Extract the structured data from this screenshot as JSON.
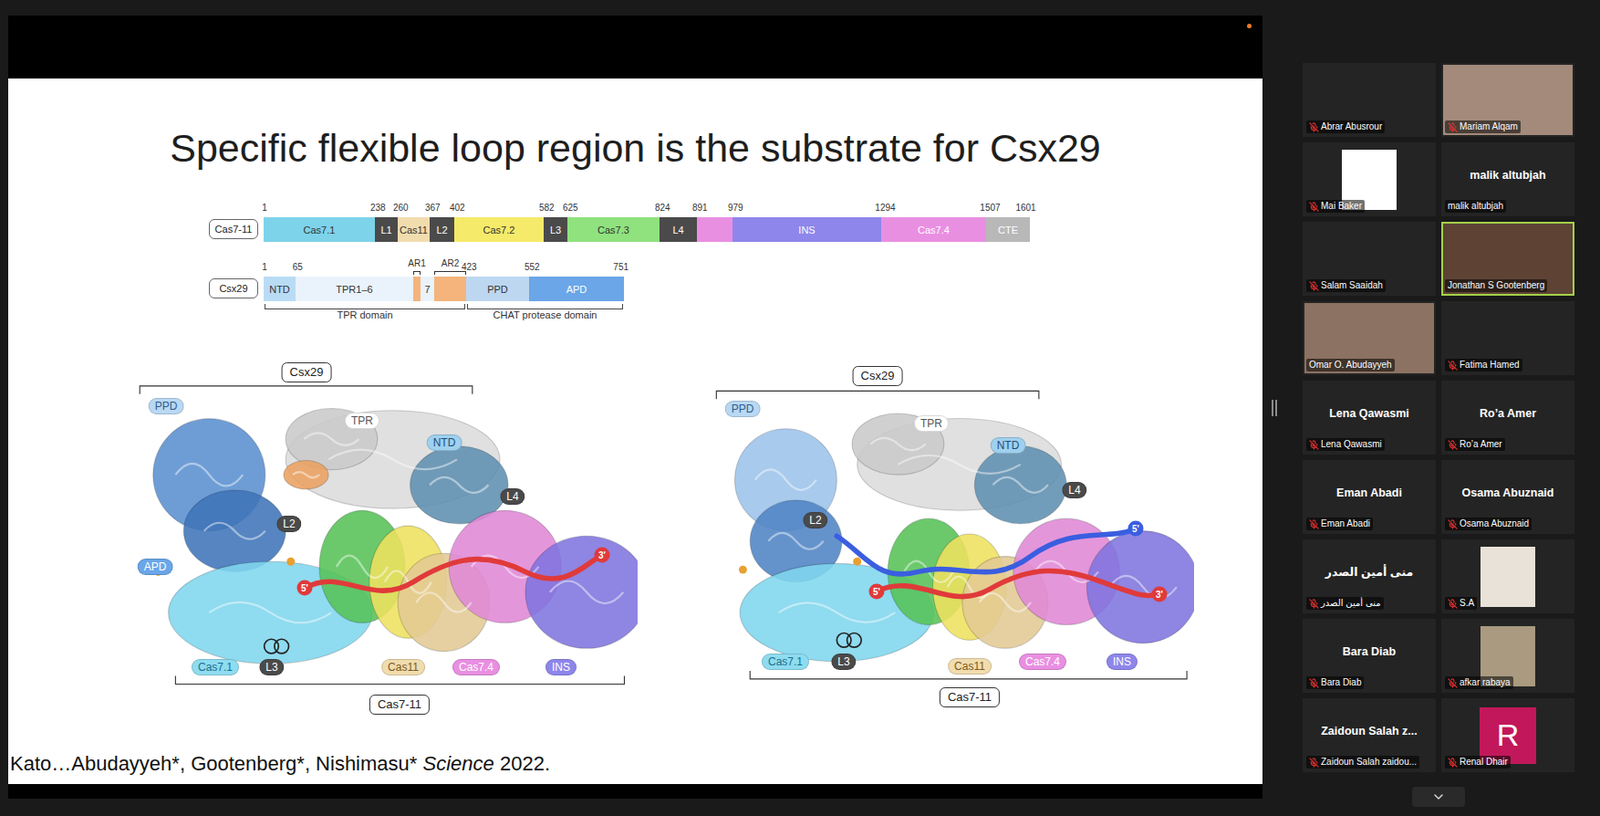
{
  "window": {
    "kind": "video-meeting"
  },
  "screen_share": {
    "slide": {
      "title": "Specific flexible loop region is the substrate for Csx29",
      "domain_maps": [
        {
          "name": "Cas7-11",
          "end": "1601",
          "segments": [
            {
              "label": "Cas7.1",
              "start": "1",
              "color": "#7dd3ea",
              "ink": "#333333"
            },
            {
              "label": "L1",
              "start": "238",
              "color": "#4a4a4a",
              "ink": "#ffffff"
            },
            {
              "label": "Cas11",
              "start": "260",
              "color": "#f1dcae",
              "ink": "#333333"
            },
            {
              "label": "L2",
              "start": "367",
              "color": "#4a4a4a",
              "ink": "#ffffff"
            },
            {
              "label": "Cas7.2",
              "start": "402",
              "color": "#f6ea6a",
              "ink": "#333333"
            },
            {
              "label": "L3",
              "start": "582",
              "color": "#4a4a4a",
              "ink": "#ffffff"
            },
            {
              "label": "Cas7.3",
              "start": "625",
              "color": "#8fe27e",
              "ink": "#333333"
            },
            {
              "label": "L4",
              "start": "824",
              "color": "#4a4a4a",
              "ink": "#ffffff"
            },
            {
              "label": "",
              "start": "891",
              "color": "#e98fe2",
              "ink": "#ffffff"
            },
            {
              "label": "INS",
              "start": "979",
              "color": "#8e86ea",
              "ink": "#ffffff"
            },
            {
              "label": "Cas7.4",
              "start": "1294",
              "color": "#e98fe2",
              "ink": "#ffffff"
            },
            {
              "label": "CTE",
              "start": "1507",
              "color": "#b8b8b8",
              "ink": "#ffffff"
            }
          ]
        },
        {
          "name": "Csx29",
          "end": "751",
          "groups": [
            {
              "label": "TPR domain",
              "segments": [
                {
                  "label": "NTD",
                  "start": "1",
                  "color": "#b9dcf5",
                  "ink": "#333333"
                },
                {
                  "label": "TPR1–6",
                  "start": "65",
                  "color": "#eaf3fc",
                  "ink": "#333333"
                },
                {
                  "label": "",
                  "tag": "AR1",
                  "color": "#f4b47c",
                  "ink": "#333333"
                },
                {
                  "label": "7",
                  "color": "#eaf3fc",
                  "ink": "#333333"
                },
                {
                  "label": "",
                  "tag": "AR2",
                  "color": "#f4b47c",
                  "ink": "#333333"
                }
              ]
            },
            {
              "label": "CHAT protease domain",
              "segments": [
                {
                  "label": "PPD",
                  "start": "423",
                  "color": "#bdd7f1",
                  "ink": "#333333"
                },
                {
                  "label": "APD",
                  "start": "552",
                  "color": "#6aa6e8",
                  "ink": "#ffffff"
                }
              ]
            }
          ]
        }
      ],
      "figures": [
        {
          "labels": [
            {
              "text": "Csx29",
              "kind": "bracket",
              "color": "#ffffff",
              "ink": "#222222"
            },
            {
              "text": "PPD",
              "kind": "pill",
              "color": "#b9d8f3",
              "ink": "#2f5d8c"
            },
            {
              "text": "TPR",
              "kind": "pill",
              "color": "#ffffff",
              "ink": "#555555"
            },
            {
              "text": "NTD",
              "kind": "pill",
              "color": "#9fd0ee",
              "ink": "#1f4f7a"
            },
            {
              "text": "L2",
              "kind": "pill",
              "color": "#4a4a4a",
              "ink": "#ffffff"
            },
            {
              "text": "L4",
              "kind": "pill",
              "color": "#4a4a4a",
              "ink": "#ffffff"
            },
            {
              "text": "APD",
              "kind": "pill",
              "color": "#6aa6e8",
              "ink": "#ffffff"
            },
            {
              "text": "5'",
              "kind": "end",
              "color": "#e03a3a",
              "ink": "#ffffff"
            },
            {
              "text": "3'",
              "kind": "end",
              "color": "#e03a3a",
              "ink": "#ffffff"
            },
            {
              "text": "Cas7.1",
              "kind": "pill",
              "color": "#8fdcf0",
              "ink": "#1a6f8a"
            },
            {
              "text": "L3",
              "kind": "pill",
              "color": "#4a4a4a",
              "ink": "#ffffff"
            },
            {
              "text": "Cas11",
              "kind": "pill",
              "color": "#f1dcae",
              "ink": "#7a5a20"
            },
            {
              "text": "Cas7.4",
              "kind": "pill",
              "color": "#e98fe2",
              "ink": "#ffffff"
            },
            {
              "text": "INS",
              "kind": "pill",
              "color": "#8e86ea",
              "ink": "#ffffff"
            },
            {
              "text": "Cas7-11",
              "kind": "bracket",
              "color": "#ffffff",
              "ink": "#222222"
            }
          ]
        },
        {
          "labels": [
            {
              "text": "Csx29",
              "kind": "bracket",
              "color": "#ffffff",
              "ink": "#222222"
            },
            {
              "text": "PPD",
              "kind": "pill",
              "color": "#b9d8f3",
              "ink": "#2f5d8c"
            },
            {
              "text": "TPR",
              "kind": "pill",
              "color": "#ffffff",
              "ink": "#555555"
            },
            {
              "text": "NTD",
              "kind": "pill",
              "color": "#9fd0ee",
              "ink": "#1f4f7a"
            },
            {
              "text": "L2",
              "kind": "pill",
              "color": "#4a4a4a",
              "ink": "#ffffff"
            },
            {
              "text": "L4",
              "kind": "pill",
              "color": "#4a4a4a",
              "ink": "#ffffff"
            },
            {
              "text": "5'",
              "kind": "end",
              "color": "#3a5ee0",
              "ink": "#ffffff"
            },
            {
              "text": "5'",
              "kind": "end",
              "color": "#e03a3a",
              "ink": "#ffffff"
            },
            {
              "text": "3'",
              "kind": "end",
              "color": "#e03a3a",
              "ink": "#ffffff"
            },
            {
              "text": "Cas7.1",
              "kind": "pill",
              "color": "#8fdcf0",
              "ink": "#1a6f8a"
            },
            {
              "text": "L3",
              "kind": "pill",
              "color": "#4a4a4a",
              "ink": "#ffffff"
            },
            {
              "text": "Cas11",
              "kind": "pill",
              "color": "#f1dcae",
              "ink": "#7a5a20"
            },
            {
              "text": "Cas7.4",
              "kind": "pill",
              "color": "#e98fe2",
              "ink": "#ffffff"
            },
            {
              "text": "INS",
              "kind": "pill",
              "color": "#8e86ea",
              "ink": "#ffffff"
            },
            {
              "text": "Cas7-11",
              "kind": "bracket",
              "color": "#ffffff",
              "ink": "#222222"
            }
          ]
        }
      ],
      "citation": {
        "authors": "Kato…Abudayyeh*, Gootenberg*, Nishimasu*",
        "journal": "Science",
        "year": "2022."
      }
    }
  },
  "gallery": {
    "participants": [
      {
        "name": "Abrar Abusrour",
        "kind": "none",
        "muted": true,
        "active_speaker": false
      },
      {
        "name": "Mariam Alqam",
        "kind": "video",
        "color": "#a38a7a",
        "muted": true,
        "active_speaker": false
      },
      {
        "name": "Mai Baker",
        "kind": "picture",
        "color": "#ffffff",
        "muted": true,
        "active_speaker": false
      },
      {
        "name": "malik altubjah",
        "display": "malik altubjah",
        "kind": "name",
        "muted": false,
        "active_speaker": false
      },
      {
        "name": "Salam Saaidah",
        "kind": "none",
        "muted": true,
        "active_speaker": false
      },
      {
        "name": "Jonathan S Gootenberg",
        "kind": "video",
        "color": "#5e4335",
        "muted": false,
        "active_speaker": true
      },
      {
        "name": "Omar O. Abudayyeh",
        "kind": "video",
        "color": "#8c7262",
        "muted": false,
        "active_speaker": false
      },
      {
        "name": "Fatima Hamed",
        "kind": "none",
        "muted": true,
        "active_speaker": false
      },
      {
        "name": "Lena Qawasmi",
        "display": "Lena Qawasmi",
        "kind": "name",
        "muted": true,
        "active_speaker": false
      },
      {
        "name": "Ro’a Amer",
        "display": "Ro’a Amer",
        "kind": "name",
        "muted": true,
        "active_speaker": false
      },
      {
        "name": "Eman Abadi",
        "display": "Eman Abadi",
        "kind": "name",
        "muted": true,
        "active_speaker": false
      },
      {
        "name": "Osama Abuznaid",
        "display": "Osama Abuznaid",
        "kind": "name",
        "muted": true,
        "active_speaker": false
      },
      {
        "name": "منى أمين الصدر",
        "display": "منى أمين الصدر",
        "kind": "name",
        "muted": true,
        "active_speaker": false
      },
      {
        "name": "S.A",
        "kind": "picture",
        "color": "#e8e2d8",
        "muted": true,
        "active_speaker": false
      },
      {
        "name": "Bara Diab",
        "display": "Bara Diab",
        "kind": "name",
        "muted": true,
        "active_speaker": false
      },
      {
        "name": "afkar rabaya",
        "kind": "picture",
        "color": "#a99a80",
        "muted": true,
        "active_speaker": false
      },
      {
        "name": "Zaidoun Salah zaidou...",
        "display": "Zaidoun Salah z...",
        "kind": "name",
        "muted": true,
        "active_speaker": false
      },
      {
        "name": "Renal Dhair",
        "kind": "avatar",
        "initial": "R",
        "color": "#c2185b",
        "muted": true,
        "active_speaker": false
      }
    ]
  }
}
